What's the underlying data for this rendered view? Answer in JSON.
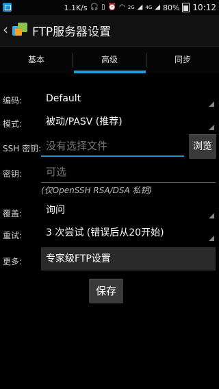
{
  "status_bar": {
    "speed": "1.1K/s",
    "network_2g": "2G",
    "network_4g": "4G",
    "battery": "80%",
    "time": "10:12"
  },
  "action_bar": {
    "title": "FTP服务器设置"
  },
  "tabs": [
    {
      "label": "基本"
    },
    {
      "label": "高级",
      "selected": true
    },
    {
      "label": "同步"
    }
  ],
  "form": {
    "encoding": {
      "label": "编码:",
      "value": "Default"
    },
    "mode": {
      "label": "模式:",
      "value": "被动/PASV (推荐)"
    },
    "ssh_key": {
      "label": "SSH 密钥:",
      "placeholder": "没有选择文件",
      "browse": "浏览"
    },
    "passphrase": {
      "label": "密钥:",
      "placeholder": "可选"
    },
    "hint": "(仅OpenSSH RSA/DSA 私钥)",
    "overwrite": {
      "label": "覆盖:",
      "value": "询问"
    },
    "retry": {
      "label": "重试:",
      "value": "3 次尝试 (错误后从20开始)"
    },
    "more": {
      "label": "更多:",
      "value": "专家级FTP设置"
    },
    "save": "保存"
  },
  "colors": {
    "accent": "#1aa1d8",
    "background": "#000000"
  }
}
